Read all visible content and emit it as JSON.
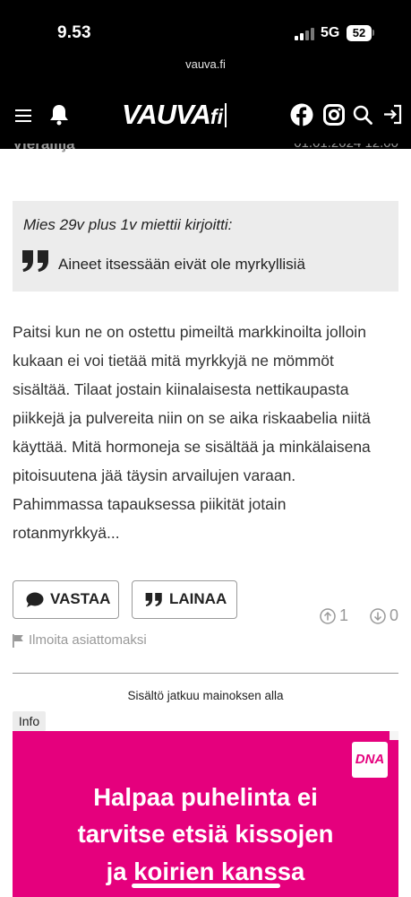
{
  "status_bar": {
    "time": "9.53",
    "network": "5G",
    "battery": "52"
  },
  "browser": {
    "url": "vauva.fi"
  },
  "header": {
    "logo_main": "VAUVA",
    "logo_suffix": "fi",
    "icons": [
      "menu-icon",
      "bell-icon",
      "facebook-icon",
      "instagram-icon",
      "search-icon",
      "login-icon"
    ]
  },
  "previous_row": {
    "author": "Vierailija",
    "date": "01.01.2024 12.00"
  },
  "quote": {
    "author_line": "Mies 29v plus 1v miettii kirjoitti:",
    "text": "Aineet itsessään eivät ole myrkyllisiä"
  },
  "post": {
    "lines": [
      "Paitsi kun ne on ostettu pimeiltä markkinoilta jolloin",
      "kukaan ei voi tietää mitä myrkkyjä ne mömmöt",
      "sisältää. Tilaat jostain kiinalaisesta nettikaupasta",
      "piikkejä ja pulvereita niin on se aika riskaabelia niitä",
      "käyttää. Mitä hormoneja se sisältää ja minkälaisena",
      "pitoisuutena jää täysin arvailujen varaan.",
      "Pahimmassa tapauksessa piikität jotain",
      "rotanmyrkkyä..."
    ]
  },
  "actions": {
    "reply_label": "VASTAA",
    "quote_label": "LAINAA",
    "upvotes": "1",
    "downvotes": "0",
    "report_label": "Ilmoita asiattomaksi"
  },
  "ad": {
    "notice": "Sisältö jatkuu mainoksen alla",
    "info_label": "Info",
    "brand": "DNA",
    "headline_lines": [
      "Halpaa puhelinta ei",
      "tarvitse etsiä kissojen",
      "ja koirien kanssa"
    ],
    "color": "#e5007d"
  }
}
